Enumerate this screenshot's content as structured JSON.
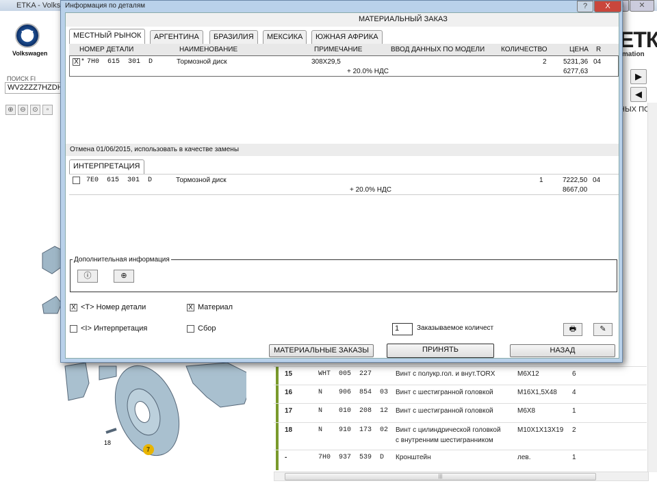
{
  "app": {
    "title": "ETKA - Volkswagen",
    "brand": "Volkswagen",
    "logo_text": "EТКА",
    "logo_sub": "rmation",
    "search_label": "ПОИСК FI",
    "search_value": "WV2ZZZ7HZDH",
    "column_partial": "НЫХ ПО"
  },
  "background_table": [
    {
      "pos": "15",
      "part": "WHT  005  227",
      "name": "Винт с полукр.гол. и внут.TORX",
      "note": "M6X12",
      "qty": "6"
    },
    {
      "pos": "16",
      "part": "N    906  854  03",
      "name": "Винт с шестигранной головкой",
      "note": "M16X1,5X48",
      "qty": "4"
    },
    {
      "pos": "17",
      "part": "N    010  208  12",
      "name": "Винт с шестигранной головкой",
      "note": "M6X8",
      "qty": "1"
    },
    {
      "pos": "18",
      "part": "N    910  173  02",
      "name": "Винт с цилиндрической головкой",
      "name2": "с внутренним шестигранником",
      "note": "M10X1X13X19",
      "qty": "2"
    },
    {
      "pos": "-",
      "part": "7H0  937  539  D",
      "name": "Кронштейн",
      "note": "лев.",
      "qty": "1"
    }
  ],
  "diagram": {
    "label_18": "18",
    "label_7": "7"
  },
  "dialog": {
    "title": "Информация по деталям",
    "header": "МАТЕРИАЛЬНЫЙ ЗАКАЗ",
    "tabs": [
      "МЕСТНЫЙ РЫНОК",
      "АРГЕНТИНА",
      "БРАЗИЛИЯ",
      "МЕКСИКА",
      "ЮЖНАЯ АФРИКА"
    ],
    "columns": [
      "НОМЕР ДЕТАЛИ",
      "НАИМЕНОВАНИЕ",
      "ПРИМЕЧАНИЕ",
      "ВВОД ДАННЫХ ПО МОДЕЛИ",
      "КОЛИЧЕСТВО",
      "ЦЕНА",
      "R"
    ],
    "main_row": {
      "checked": "X",
      "star": "*",
      "part": "7H0  615  301  D",
      "name": "Тормозной диск",
      "note": "308X29,5",
      "qty": "2",
      "price": "5231,36",
      "r": "04",
      "vat": "+ 20.0% НДС",
      "price_vat": "6277,63"
    },
    "replacement_note": "Отмена 01/06/2015, использовать в качестве замены",
    "interp_tab": "ИНТЕРПРЕТАЦИЯ",
    "interp_row": {
      "part": "7E0  615  301  D",
      "name": "Тормозной диск",
      "qty": "1",
      "price": "7222,50",
      "r": "04",
      "vat": "+ 20.0% НДС",
      "price_vat": "8667,00"
    },
    "extra_info_label": "Дополнительная информация",
    "checkboxes": [
      {
        "label": "<T> Номер детали",
        "checked": "X"
      },
      {
        "label": "Материал",
        "checked": "X"
      },
      {
        "label": "<I> Интерпретация",
        "checked": ""
      },
      {
        "label": "Сбор",
        "checked": ""
      }
    ],
    "order_qty": "1",
    "order_qty_label": "Заказываемое количест",
    "buttons": {
      "orders": "МАТЕРИАЛЬНЫЕ ЗАКАЗЫ",
      "accept": "ПРИНЯТЬ",
      "back": "НАЗАД"
    },
    "help": "?",
    "close": "X"
  }
}
